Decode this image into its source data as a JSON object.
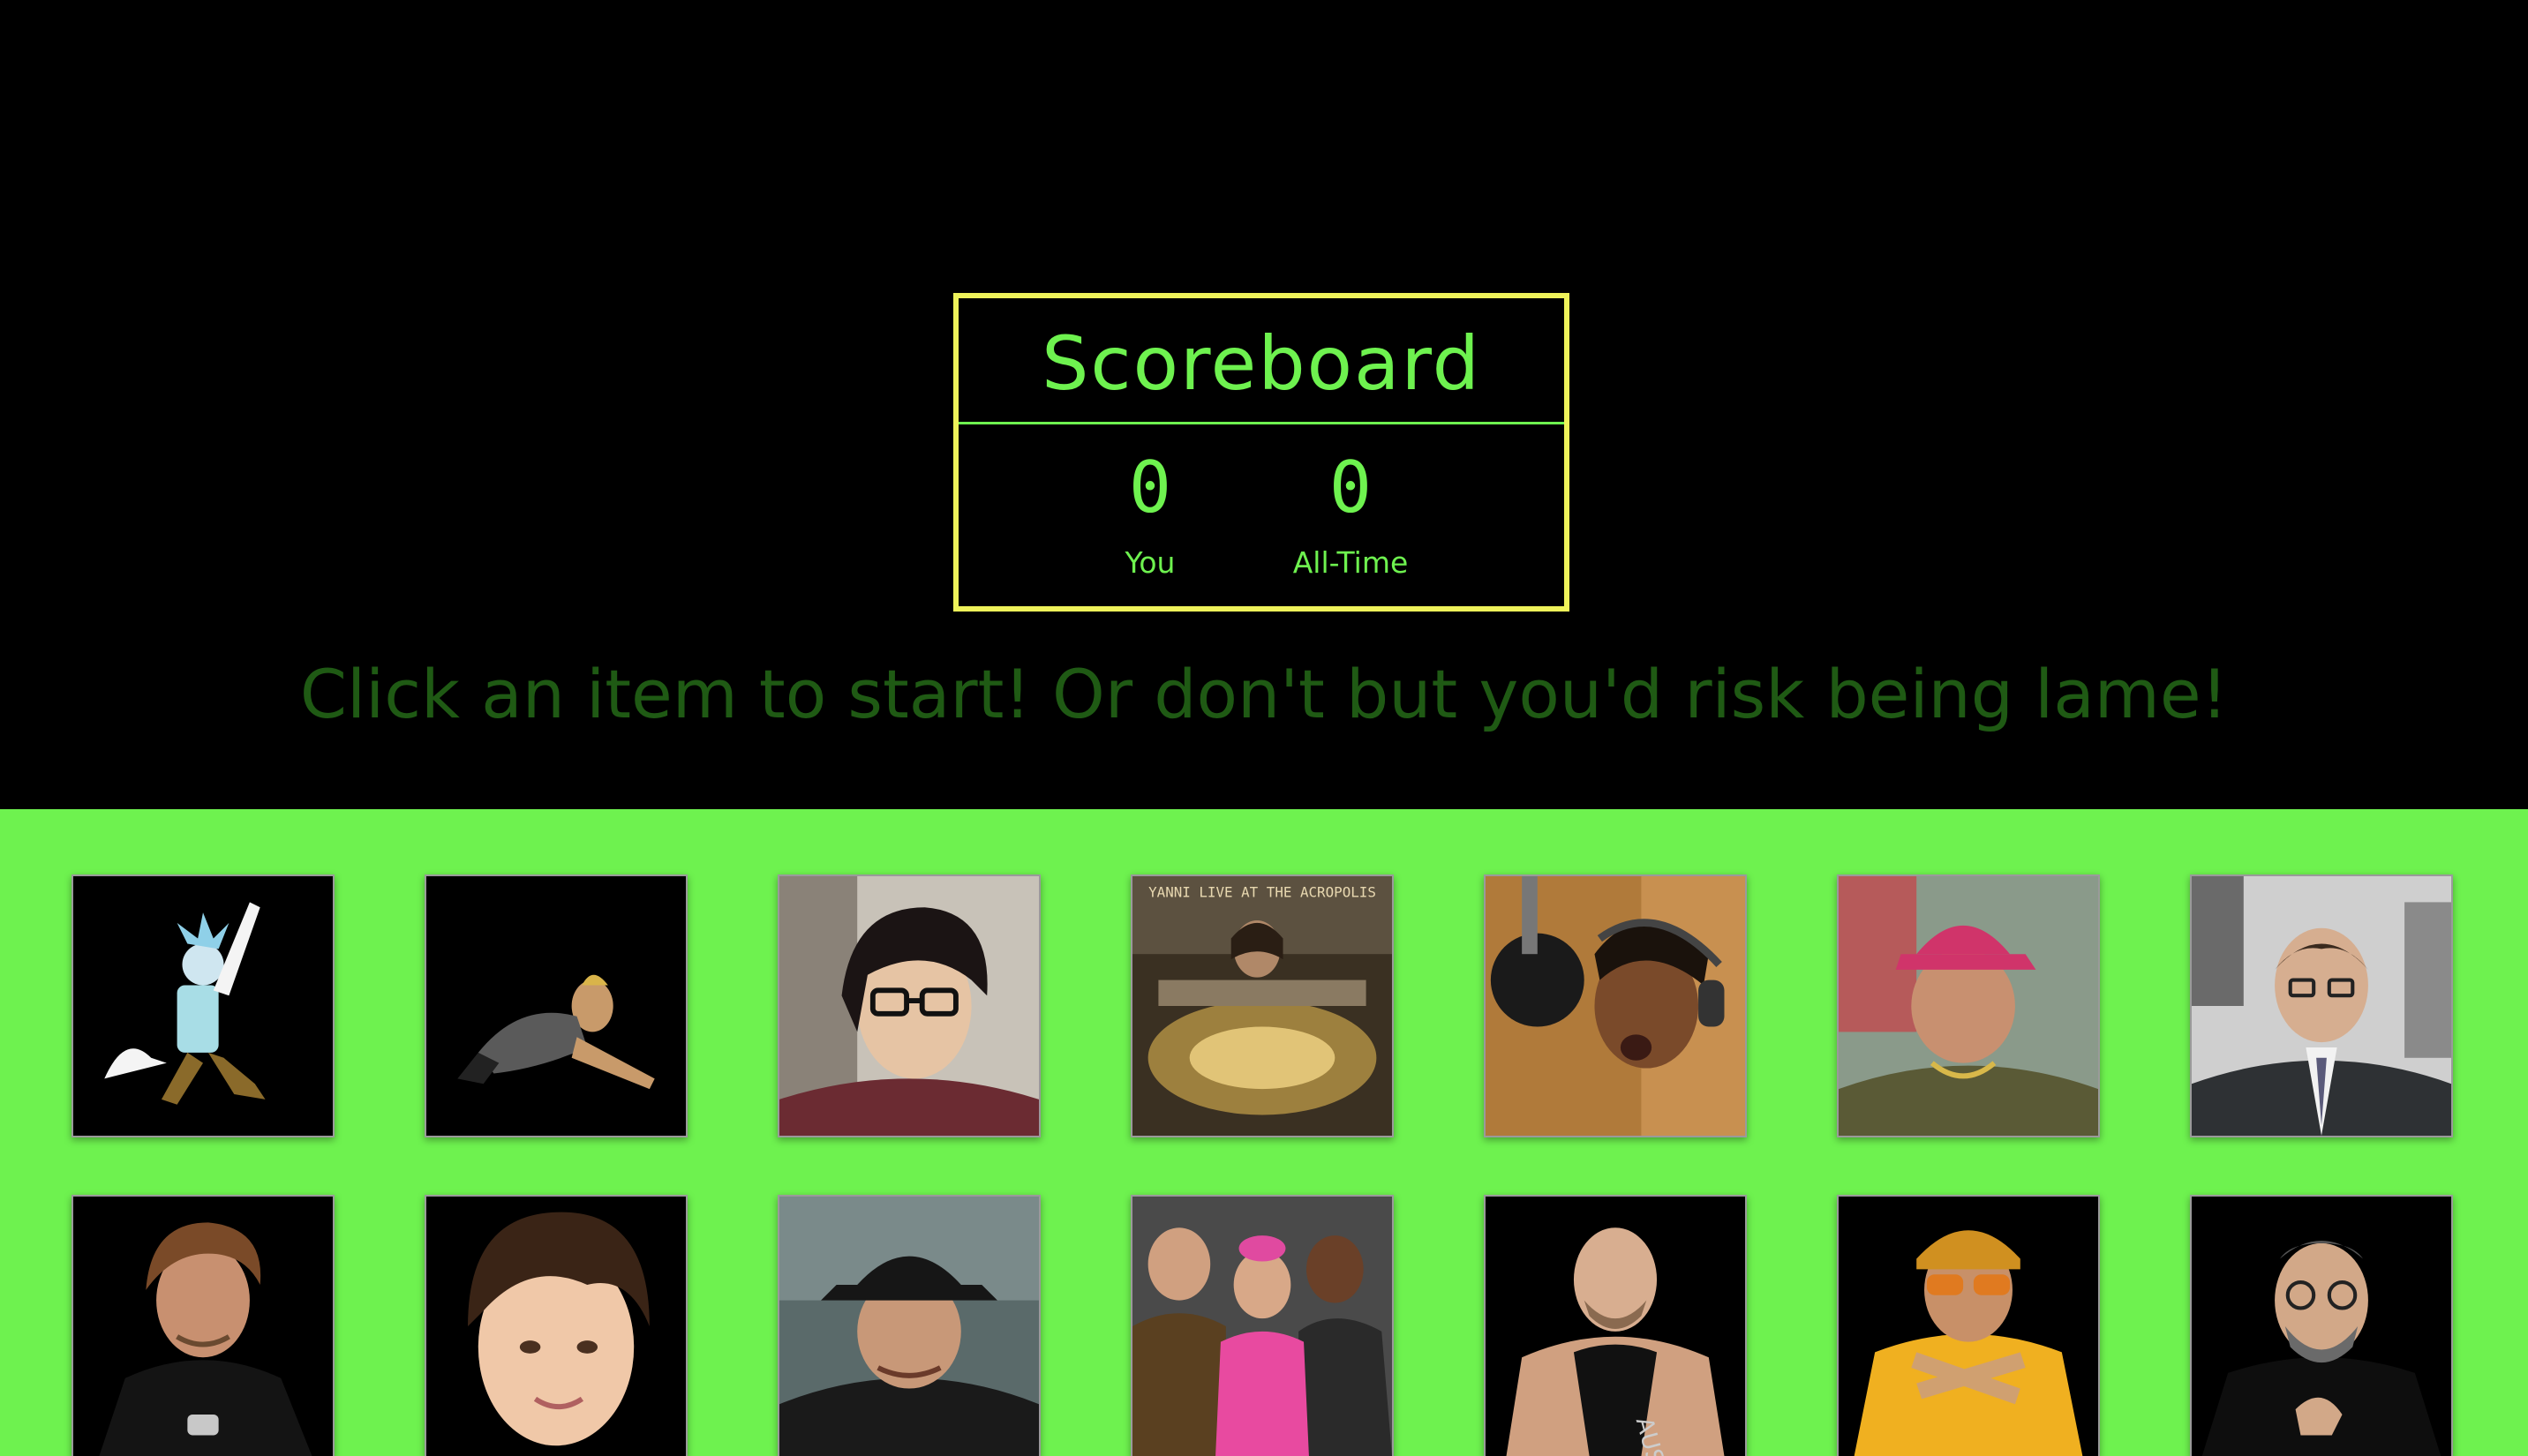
{
  "scoreboard": {
    "title": "Scoreboard",
    "you_score": "0",
    "you_label": "You",
    "all_time_score": "0",
    "all_time_label": "All-Time"
  },
  "message": "Click an item to start! Or don't but you'd risk being lame!",
  "cards": [
    {
      "name": "rick-cartoon-card"
    },
    {
      "name": "crouching-man-card"
    },
    {
      "name": "man-glasses-card"
    },
    {
      "name": "yanni-album-card",
      "caption": "YANNI LIVE AT THE ACROPOLIS"
    },
    {
      "name": "singing-man-card"
    },
    {
      "name": "man-pink-hat-card"
    },
    {
      "name": "man-suit-office-card"
    },
    {
      "name": "george-michael-card"
    },
    {
      "name": "bieber-card"
    },
    {
      "name": "man-bucket-hat-card"
    },
    {
      "name": "pink-outfit-group-card"
    },
    {
      "name": "wrestler-card"
    },
    {
      "name": "ali-g-card"
    },
    {
      "name": "steve-jobs-card"
    }
  ],
  "colors": {
    "accent_green": "#6ef24f",
    "frame_yellow": "#eef25a",
    "message_green": "#1f5a14",
    "background": "#000000"
  }
}
